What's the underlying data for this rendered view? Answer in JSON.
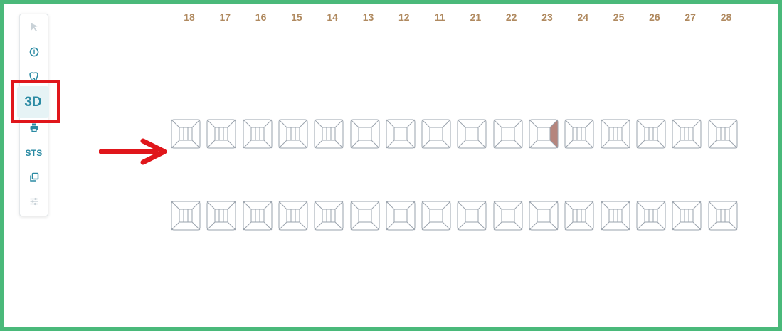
{
  "toolbar": {
    "items": [
      {
        "name": "pointer-tool",
        "icon": "cursor-arrow-icon",
        "state": "disabled"
      },
      {
        "name": "info-tool",
        "icon": "info-circle-icon",
        "state": "enabled"
      },
      {
        "name": "tooth-tool",
        "icon": "tooth-icon",
        "state": "enabled"
      },
      {
        "name": "3d-view",
        "label": "3D",
        "state": "active"
      },
      {
        "name": "print-tool",
        "icon": "printer-icon",
        "state": "enabled"
      },
      {
        "name": "sts-tool",
        "label": "STS",
        "state": "enabled"
      },
      {
        "name": "copy-tool",
        "icon": "copy-icon",
        "state": "enabled"
      },
      {
        "name": "settings-tool",
        "icon": "sliders-icon",
        "state": "disabled"
      }
    ]
  },
  "annotations": {
    "highlight_color": "#e0161b",
    "arrow_color": "#e0161b",
    "frame_color": "#4ab97a"
  },
  "chart": {
    "tooth_numbers": [
      "18",
      "17",
      "16",
      "15",
      "14",
      "13",
      "12",
      "11",
      "21",
      "22",
      "23",
      "24",
      "25",
      "26",
      "27",
      "28"
    ],
    "upper_row": [
      {
        "number": "18",
        "type": "molar"
      },
      {
        "number": "17",
        "type": "molar"
      },
      {
        "number": "16",
        "type": "molar"
      },
      {
        "number": "15",
        "type": "molar"
      },
      {
        "number": "14",
        "type": "molar"
      },
      {
        "number": "13",
        "type": "anterior"
      },
      {
        "number": "12",
        "type": "anterior"
      },
      {
        "number": "11",
        "type": "anterior"
      },
      {
        "number": "21",
        "type": "anterior"
      },
      {
        "number": "22",
        "type": "anterior"
      },
      {
        "number": "23",
        "type": "anterior",
        "marked_surface": "right",
        "marked_color": "#b5857d"
      },
      {
        "number": "24",
        "type": "molar"
      },
      {
        "number": "25",
        "type": "molar"
      },
      {
        "number": "26",
        "type": "molar"
      },
      {
        "number": "27",
        "type": "molar"
      },
      {
        "number": "28",
        "type": "molar"
      }
    ],
    "lower_row": [
      {
        "type": "molar"
      },
      {
        "type": "molar"
      },
      {
        "type": "molar"
      },
      {
        "type": "molar"
      },
      {
        "type": "molar"
      },
      {
        "type": "anterior"
      },
      {
        "type": "anterior"
      },
      {
        "type": "anterior"
      },
      {
        "type": "anterior"
      },
      {
        "type": "anterior"
      },
      {
        "type": "anterior"
      },
      {
        "type": "molar"
      },
      {
        "type": "molar"
      },
      {
        "type": "molar"
      },
      {
        "type": "molar"
      },
      {
        "type": "molar"
      }
    ],
    "label_color": "#b08a60",
    "outline_color": "#9aa3ad"
  }
}
